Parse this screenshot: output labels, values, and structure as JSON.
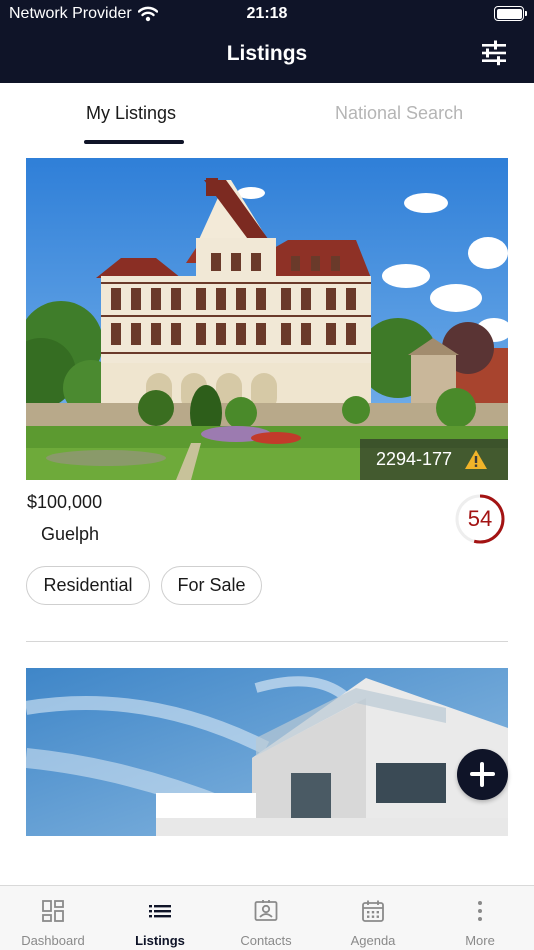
{
  "status_bar": {
    "carrier": "Network Provider",
    "time": "21:18"
  },
  "nav": {
    "title": "Listings",
    "filter_icon": "sliders-icon"
  },
  "tabs": [
    {
      "label": "My Listings",
      "active": true
    },
    {
      "label": "National Search",
      "active": false
    }
  ],
  "listings": [
    {
      "mls_number": "2294-177",
      "warning_icon": "warning-icon",
      "price": "$100,000",
      "city": "Guelph",
      "score": "54",
      "score_fraction": 0.54,
      "tags": [
        "Residential",
        "For Sale"
      ]
    },
    {
      "image": "modern-house-photo"
    }
  ],
  "fab": {
    "icon": "plus-icon"
  },
  "tab_bar": [
    {
      "label": "Dashboard",
      "icon": "dashboard-icon",
      "active": false
    },
    {
      "label": "Listings",
      "icon": "list-icon",
      "active": true
    },
    {
      "label": "Contacts",
      "icon": "contact-card-icon",
      "active": false
    },
    {
      "label": "Agenda",
      "icon": "calendar-icon",
      "active": false
    },
    {
      "label": "More",
      "icon": "more-vertical-icon",
      "active": false
    }
  ],
  "colors": {
    "nav_bg": "#0f1428",
    "score_ring": "#a31313",
    "inactive_tab": "#b5b5b5"
  }
}
